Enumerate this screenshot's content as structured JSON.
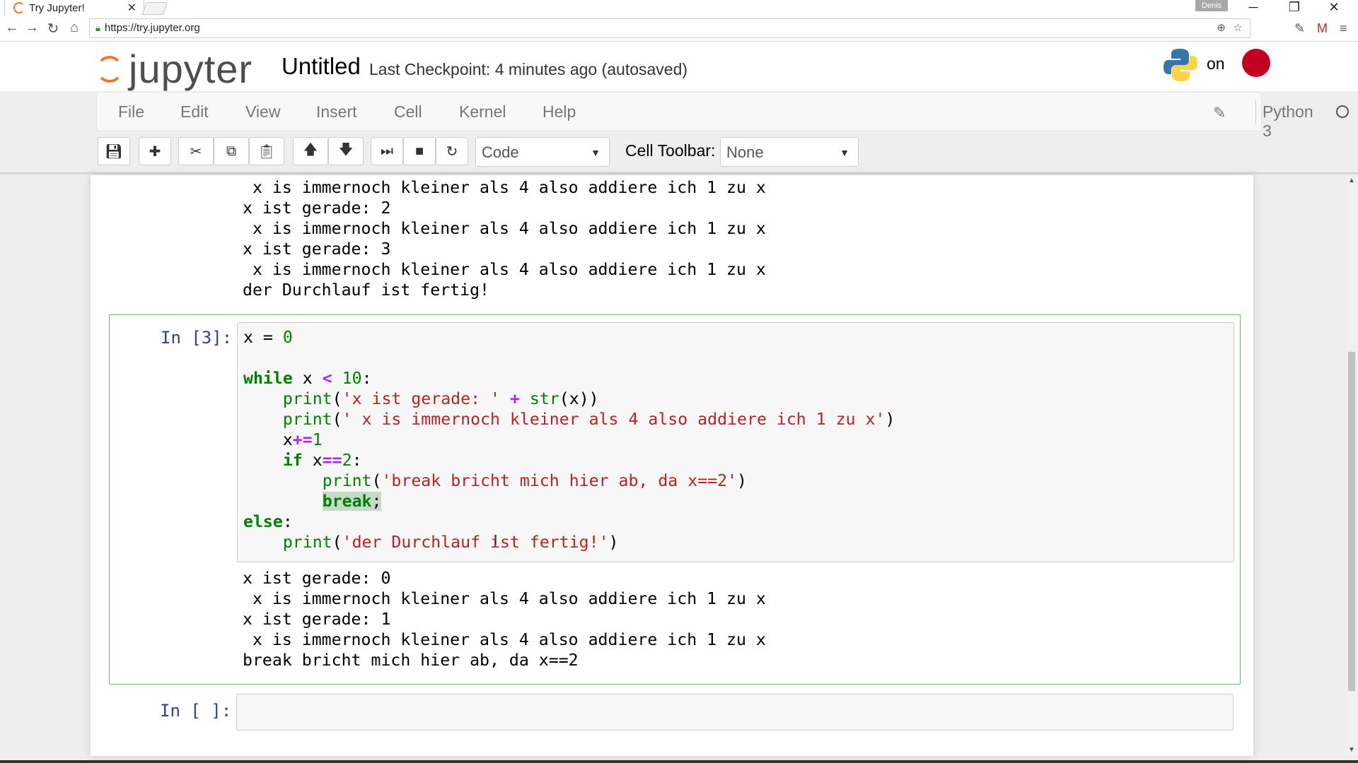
{
  "browser": {
    "tab_title": "Try Jupyter!",
    "url": "https://try.jupyter.org",
    "user_badge": "Denis"
  },
  "header": {
    "logo_text": "jupyter",
    "notebook_title": "Untitled",
    "checkpoint": "Last Checkpoint: 4 minutes ago (autosaved)",
    "on_text": "on"
  },
  "menu": {
    "items": [
      "File",
      "Edit",
      "View",
      "Insert",
      "Cell",
      "Kernel",
      "Help"
    ],
    "kernel_name": "Python 3"
  },
  "toolbar": {
    "cell_type": "Code",
    "cell_toolbar_label": "Cell Toolbar:",
    "cell_toolbar_value": "None",
    "icons": [
      "save-icon",
      "plus-icon",
      "scissors-icon",
      "copy-icon",
      "paste-icon",
      "arrow-up-icon",
      "arrow-down-icon",
      "run-next-icon",
      "stop-icon",
      "restart-icon"
    ]
  },
  "notebook": {
    "prev_output": [
      " x is immernoch kleiner als 4 also addiere ich 1 zu x",
      "x ist gerade: 2",
      " x is immernoch kleiner als 4 also addiere ich 1 zu x",
      "x ist gerade: 3",
      " x is immernoch kleiner als 4 also addiere ich 1 zu x",
      "der Durchlauf ist fertig!"
    ],
    "cell3": {
      "prompt": "In [3]:",
      "code": {
        "l1_var": "x",
        "l1_eq": " = ",
        "l1_num": "0",
        "l3_kw": "while",
        "l3_rest": " x ",
        "l3_op": "<",
        "l3_sp": " ",
        "l3_num": "10",
        "l3_colon": ":",
        "l4_indent": "    ",
        "l4_fn": "print",
        "l4_p1": "(",
        "l4_str": "'x ist gerade: '",
        "l4_sp": " ",
        "l4_op": "+",
        "l4_sp2": " ",
        "l4_fn2": "str",
        "l4_rest": "(x))",
        "l5_fn": "print",
        "l5_p1": "(",
        "l5_str": "' x is immernoch kleiner als 4 also addiere ich 1 zu x'",
        "l5_p2": ")",
        "l6_var": "x",
        "l6_op": "+=",
        "l6_num": "1",
        "l7_kw": "if",
        "l7_var": " x",
        "l7_op": "==",
        "l7_num": "2",
        "l7_colon": ":",
        "l8_indent": "        ",
        "l8_fn": "print",
        "l8_p1": "(",
        "l8_str": "'break bricht mich hier ab, da x==2'",
        "l8_p2": ")",
        "l9_kw": "break",
        "l9_semi": ";",
        "l10_kw": "else",
        "l10_colon": ":",
        "l11_fn": "print",
        "l11_p1": "(",
        "l11_str": "'der Durchlauf ist fertig!'",
        "l11_p2": ")"
      },
      "output": [
        "x ist gerade: 0",
        " x is immernoch kleiner als 4 also addiere ich 1 zu x",
        "x ist gerade: 1",
        " x is immernoch kleiner als 4 also addiere ich 1 zu x",
        "break bricht mich hier ab, da x==2"
      ]
    },
    "cell4": {
      "prompt": "In [ ]:"
    }
  },
  "colors": {
    "jupyter_orange": "#f37726",
    "selected_cell_border": "#66bb6a",
    "prompt_blue": "#303f9f"
  }
}
